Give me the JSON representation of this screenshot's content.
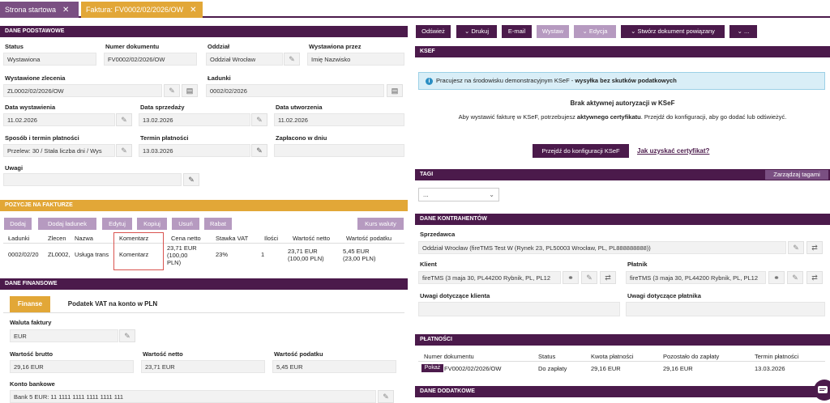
{
  "tabs": [
    {
      "label": "Strona startowa",
      "close": "✕"
    },
    {
      "label": "Faktura: FV0002/02/2026/OW",
      "close": "✕"
    }
  ],
  "basic": {
    "header": "DANE PODSTAWOWE",
    "status_label": "Status",
    "status": "Wystawiona",
    "number_label": "Numer dokumentu",
    "number": "FV0002/02/2026/OW",
    "branch_label": "Oddział",
    "branch": "Oddział Wrocław",
    "issuer_label": "Wystawiona przez",
    "issuer": "Imię Nazwisko",
    "orders_label": "Wystawione zlecenia",
    "orders": "ZL0002/02/2026/OW",
    "loads_label": "Ładunki",
    "loads": "0002/02/2026",
    "issue_date_label": "Data wystawienia",
    "issue_date": "11.02.2026",
    "sale_date_label": "Data sprzedaży",
    "sale_date": "13.02.2026",
    "created_label": "Data utworzenia",
    "created": "11.02.2026",
    "payment_method_label": "Sposób i termin płatności",
    "payment_method": "Przelew: 30 / Stała liczba dni / Wys",
    "due_label": "Termin płatności",
    "due": "13.03.2026",
    "paid_label": "Zapłacono w dniu",
    "paid": "",
    "notes_label": "Uwagi",
    "notes": ""
  },
  "items": {
    "header": "POZYCJE NA FAKTURZE",
    "buttons": [
      "Dodaj",
      "Dodaj ładunek",
      "Edytuj",
      "Kopiuj",
      "Usuń",
      "Rabat"
    ],
    "currency_btn": "Kurs waluty",
    "columns": [
      "Ładunki",
      "Zlecen",
      "Nazwa",
      "Komentarz",
      "Cena netto",
      "Stawka VAT",
      "Ilości",
      "Wartość netto",
      "Wartość podatku"
    ],
    "row": {
      "loads": "0002/02/20",
      "order": "ZL0002,",
      "name": "Usługa trans",
      "comment": "Komentarz",
      "price1": "23,71 EUR",
      "price2": "(100,00",
      "price3": "PLN)",
      "vat": "23%",
      "qty": "1",
      "net1": "23,71 EUR",
      "net2": "(100,00 PLN)",
      "tax1": "5,45 EUR",
      "tax2": "(23,00 PLN)"
    }
  },
  "finance": {
    "header": "DANE FINANSOWE",
    "tab1": "Finanse",
    "tab2": "Podatek VAT na konto w PLN",
    "currency_label": "Waluta faktury",
    "currency": "EUR",
    "gross_label": "Wartość brutto",
    "gross": "29,16 EUR",
    "net_label": "Wartość netto",
    "net": "23,71 EUR",
    "tax_label": "Wartość podatku",
    "tax": "5,45 EUR",
    "bank_label": "Konto bankowe",
    "bank": "Bank 5 EUR: 11 1111 1111 1111 1111 111"
  },
  "toolbar": [
    "Odśwież",
    "Drukuj",
    "E-mail",
    "Wystaw",
    "Edycja",
    "Stwórz dokument powiązany",
    "..."
  ],
  "ksef": {
    "header": "KSEF",
    "info_plain": "Pracujesz na środowisku demonstracyjnym KSeF - ",
    "info_bold": "wysyłka bez skutków podatkowych",
    "title": "Brak aktywnej autoryzacji w KSeF",
    "desc_a": "Aby wystawić fakturę w KSeF, potrzebujesz ",
    "desc_b": "aktywnego certyfikatu",
    "desc_c": ". Przejdź do konfiguracji, aby go dodać lub odświeżyć.",
    "config_btn": "Przejdź do konfiguracji KSeF",
    "cert_link": "Jak uzyskać certyfikat?"
  },
  "tags": {
    "header": "TAGI",
    "manage": "Zarządzaj tagami",
    "select": "..."
  },
  "parties": {
    "header": "DANE KONTRAHENTÓW",
    "seller_label": "Sprzedawca",
    "seller": "Oddział Wrocław (fireTMS Test W (Rynek 23, PL50003 Wrocław, PL, PL888888888))",
    "client_label": "Klient",
    "client": "fireTMS (3 maja 30, PL44200 Rybnik, PL, PL12",
    "payer_label": "Płatnik",
    "payer": "fireTMS (3 maja 30, PL44200 Rybnik, PL, PL12",
    "client_notes_label": "Uwagi dotyczące klienta",
    "payer_notes_label": "Uwagi dotyczące płatnika"
  },
  "payments": {
    "header": "PŁATNOŚCI",
    "columns": [
      "Numer dokumentu",
      "Status",
      "Kwota płatności",
      "Pozostało do zapłaty",
      "Termin płatności"
    ],
    "show_btn": "Pokaż",
    "row": [
      "FV0002/02/2026/OW",
      "Do zapłaty",
      "29,16 EUR",
      "29,16 EUR",
      "13.03.2026"
    ]
  },
  "extra": {
    "header": "DANE DODATKOWE"
  },
  "colors": {
    "primary": "#4b1a4b",
    "accent": "#e2a737",
    "button_light": "#b69ac0"
  }
}
